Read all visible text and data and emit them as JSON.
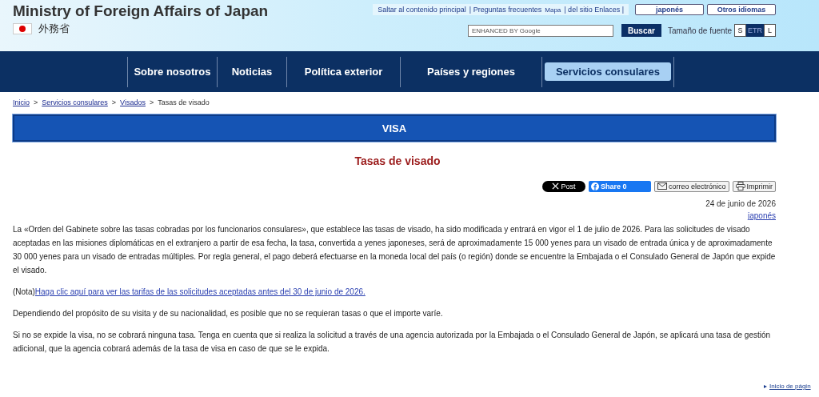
{
  "header": {
    "title": "Ministry of Foreign Affairs of Japan",
    "subtitle": "外務省",
    "utility_links": [
      "Saltar al contenido principal",
      "| Preguntas frecuentes",
      "Mapa",
      "| del sitio Enlaces |"
    ],
    "language_buttons": [
      "japonés",
      "Otros idiomas"
    ],
    "search": {
      "placeholder": "ENHANCED BY Google",
      "button": "Buscar"
    },
    "font_size": {
      "label": "Tamaño de fuente",
      "options": [
        {
          "label": "S",
          "selected": false
        },
        {
          "label": "ETR",
          "selected": true
        },
        {
          "label": "L",
          "selected": false
        }
      ]
    }
  },
  "nav": [
    {
      "label": "Sobre nosotros",
      "selected": false
    },
    {
      "label": "Noticias",
      "selected": false
    },
    {
      "label": "Política exterior",
      "selected": false
    },
    {
      "label": "Países y regiones",
      "selected": false
    },
    {
      "label": "Servicios consulares",
      "selected": true
    }
  ],
  "breadcrumb": [
    {
      "kind": "link",
      "label": "Inicio"
    },
    {
      "kind": "separator",
      "label": ">"
    },
    {
      "kind": "link",
      "label": "Servicios consulares"
    },
    {
      "kind": "separator",
      "label": ">"
    },
    {
      "kind": "link",
      "label": "Visados"
    },
    {
      "kind": "separator",
      "label": ">"
    },
    {
      "kind": "current",
      "label": "Tasas de visado"
    }
  ],
  "banner": "VISA",
  "page_title": "Tasas de visado",
  "share": {
    "post": "Post",
    "facebook": "Share 0",
    "email": "correo electrónico",
    "print": "Imprimir"
  },
  "date": "24 de junio de 2026",
  "language_link": "japonés",
  "paragraphs": [
    {
      "kind": "text",
      "text": "La «Orden del Gabinete sobre las tasas cobradas por los funcionarios consulares», que establece las tasas de visado, ha sido modificada y entrará en vigor el 1 de julio de 2026. Para las solicitudes de visado aceptadas en las misiones diplomáticas en el extranjero a partir de esa fecha, la tasa, convertida a yenes japoneses, será de aproximadamente 15 000 yenes para un visado de entrada única y de aproximadamente 30 000 yenes para un visado de entradas múltiples. Por regla general, el pago deberá efectuarse en la moneda local del país (o región) donde se encuentre la Embajada o el Consulado General de Japón que expide el visado."
    },
    {
      "kind": "note",
      "text": "(Nota)",
      "link": "Haga clic aquí para ver las tarifas de las solicitudes aceptadas antes del 30 de junio de 2026."
    },
    {
      "kind": "text",
      "text": "Dependiendo del propósito de su visita y de su nacionalidad, es posible que no se requieran tasas o que el importe varíe."
    },
    {
      "kind": "text",
      "text": "Si no se expide la visa, no se cobrará ninguna tasa. Tenga en cuenta que si realiza la solicitud a través de una agencia autorizada por la Embajada o el Consulado General de Japón, se aplicará una tasa de gestión adicional, que la agencia cobrará además de la tasa de visa en caso de que se le expida."
    }
  ],
  "back_to_top": "Inicio de págin"
}
